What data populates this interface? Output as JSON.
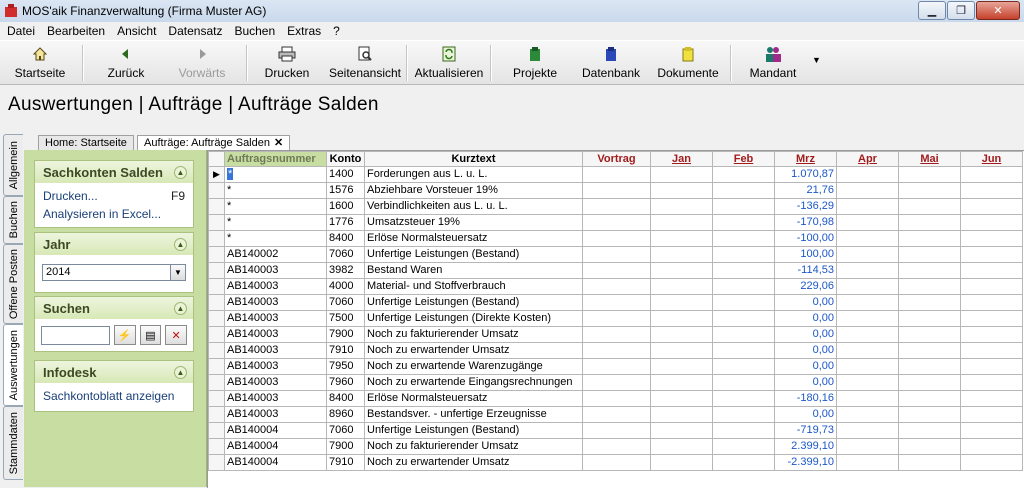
{
  "window": {
    "title": "MOS'aik Finanzverwaltung (Firma Muster AG)"
  },
  "menu": [
    "Datei",
    "Bearbeiten",
    "Ansicht",
    "Datensatz",
    "Buchen",
    "Extras",
    "?"
  ],
  "toolbar": {
    "startseite": "Startseite",
    "zurueck": "Zurück",
    "vorwaerts": "Vorwärts",
    "drucken": "Drucken",
    "seitenansicht": "Seitenansicht",
    "aktualisieren": "Aktualisieren",
    "projekte": "Projekte",
    "datenbank": "Datenbank",
    "dokumente": "Dokumente",
    "mandant": "Mandant"
  },
  "heading": "Auswertungen | Aufträge | Aufträge Salden",
  "vtabs": [
    "Allgemein",
    "Buchen",
    "Offene Posten",
    "Auswertungen",
    "Stammdaten"
  ],
  "doctabs": {
    "home": "Home: Startseite",
    "active": "Aufträge: Aufträge Salden"
  },
  "panel": {
    "sachkonten": {
      "title": "Sachkonten Salden",
      "drucken": "Drucken...",
      "drucken_key": "F9",
      "excel": "Analysieren in Excel..."
    },
    "jahr": {
      "title": "Jahr",
      "value": "2014"
    },
    "suchen": {
      "title": "Suchen",
      "value": ""
    },
    "infodesk": {
      "title": "Infodesk",
      "link": "Sachkontoblatt anzeigen"
    }
  },
  "table": {
    "columns": [
      "Auftragsnummer",
      "Konto",
      "Kurztext",
      "Vortrag",
      "Jan",
      "Feb",
      "Mrz",
      "Apr",
      "Mai",
      "Jun"
    ],
    "rows": [
      [
        "*",
        "1400",
        "Forderungen aus L. u. L.",
        "",
        "",
        "",
        "1.070,87",
        "",
        "",
        ""
      ],
      [
        "*",
        "1576",
        "Abziehbare Vorsteuer 19%",
        "",
        "",
        "",
        "21,76",
        "",
        "",
        ""
      ],
      [
        "*",
        "1600",
        "Verbindlichkeiten aus L. u. L.",
        "",
        "",
        "",
        "-136,29",
        "",
        "",
        ""
      ],
      [
        "*",
        "1776",
        "Umsatzsteuer 19%",
        "",
        "",
        "",
        "-170,98",
        "",
        "",
        ""
      ],
      [
        "*",
        "8400",
        "Erlöse Normalsteuersatz",
        "",
        "",
        "",
        "-100,00",
        "",
        "",
        ""
      ],
      [
        "AB140002",
        "7060",
        "Unfertige Leistungen (Bestand)",
        "",
        "",
        "",
        "100,00",
        "",
        "",
        ""
      ],
      [
        "AB140003",
        "3982",
        "Bestand Waren",
        "",
        "",
        "",
        "-114,53",
        "",
        "",
        ""
      ],
      [
        "AB140003",
        "4000",
        "Material- und Stoffverbrauch",
        "",
        "",
        "",
        "229,06",
        "",
        "",
        ""
      ],
      [
        "AB140003",
        "7060",
        "Unfertige Leistungen (Bestand)",
        "",
        "",
        "",
        "0,00",
        "",
        "",
        ""
      ],
      [
        "AB140003",
        "7500",
        "Unfertige Leistungen (Direkte Kosten)",
        "",
        "",
        "",
        "0,00",
        "",
        "",
        ""
      ],
      [
        "AB140003",
        "7900",
        "Noch zu fakturierender Umsatz",
        "",
        "",
        "",
        "0,00",
        "",
        "",
        ""
      ],
      [
        "AB140003",
        "7910",
        "Noch zu erwartender Umsatz",
        "",
        "",
        "",
        "0,00",
        "",
        "",
        ""
      ],
      [
        "AB140003",
        "7950",
        "Noch zu erwartende Warenzugänge",
        "",
        "",
        "",
        "0,00",
        "",
        "",
        ""
      ],
      [
        "AB140003",
        "7960",
        "Noch zu erwartende Eingangsrechnungen",
        "",
        "",
        "",
        "0,00",
        "",
        "",
        ""
      ],
      [
        "AB140003",
        "8400",
        "Erlöse Normalsteuersatz",
        "",
        "",
        "",
        "-180,16",
        "",
        "",
        ""
      ],
      [
        "AB140003",
        "8960",
        "Bestandsver. - unfertige Erzeugnisse",
        "",
        "",
        "",
        "0,00",
        "",
        "",
        ""
      ],
      [
        "AB140004",
        "7060",
        "Unfertige Leistungen (Bestand)",
        "",
        "",
        "",
        "-719,73",
        "",
        "",
        ""
      ],
      [
        "AB140004",
        "7900",
        "Noch zu fakturierender Umsatz",
        "",
        "",
        "",
        "2.399,10",
        "",
        "",
        ""
      ],
      [
        "AB140004",
        "7910",
        "Noch zu erwartender Umsatz",
        "",
        "",
        "",
        "-2.399,10",
        "",
        "",
        ""
      ]
    ]
  }
}
